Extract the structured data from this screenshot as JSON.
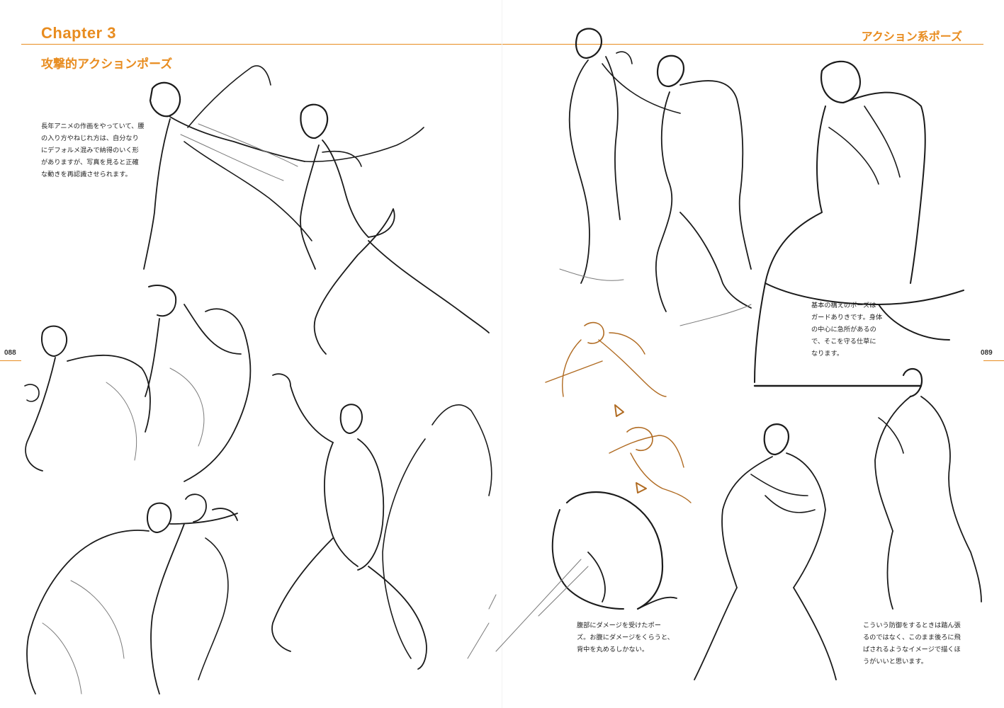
{
  "header": {
    "chapter": "Chapter 3",
    "section_title": "攻撃的アクションポーズ",
    "running_head": "アクション系ポーズ"
  },
  "page_numbers": {
    "left": "088",
    "right": "089"
  },
  "captions": {
    "intro": [
      "長年アニメの作画をやっていて、腰",
      "の入り方やねじれ方は、自分なり",
      "にデフォルメ混みで納得のいく形",
      "がありますが、写真を見ると正確",
      "な動きを再認識させられます。"
    ],
    "guard": [
      "基本の構えのポーズは",
      "ガードありきです。身体",
      "の中心に急所があるの",
      "で、そこを守る仕草に",
      "なります。"
    ],
    "damage": [
      "腹部にダメージを受けたポー",
      "ズ。お腹にダメージをくらうと、",
      "背中を丸めるしかない。"
    ],
    "defense": [
      "こういう防御をするときは踏ん張",
      "るのではなく、このまま後ろに飛",
      "ばされるようなイメージで描くほ",
      "うがいいと思います。"
    ]
  },
  "colors": {
    "accent": "#e88c1f",
    "ink": "#1b1b1b",
    "sepia_sketch": "#b06b22",
    "page": "#ffffff"
  }
}
